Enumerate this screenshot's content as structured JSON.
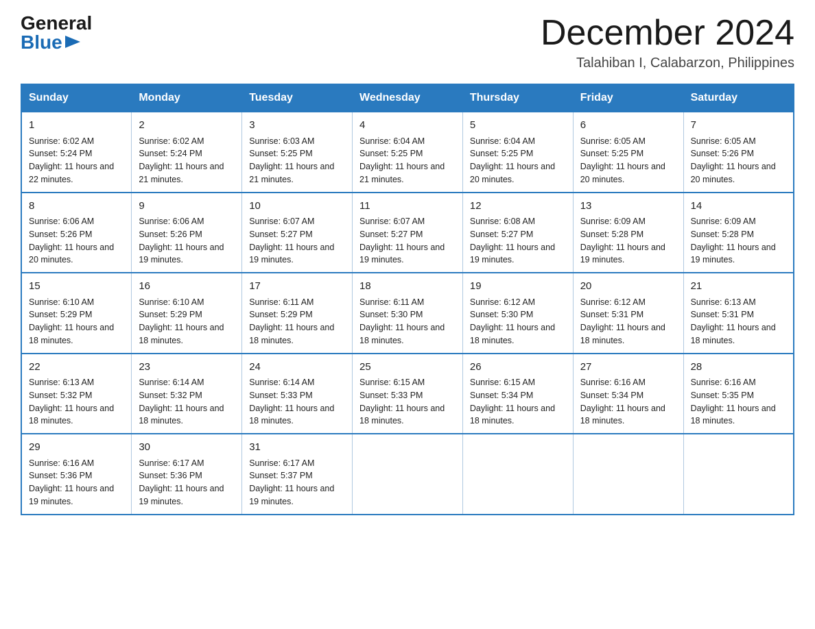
{
  "header": {
    "logo_general": "General",
    "logo_blue": "Blue",
    "month_year": "December 2024",
    "location": "Talahiban I, Calabarzon, Philippines"
  },
  "weekdays": [
    "Sunday",
    "Monday",
    "Tuesday",
    "Wednesday",
    "Thursday",
    "Friday",
    "Saturday"
  ],
  "weeks": [
    [
      {
        "day": "1",
        "sunrise": "6:02 AM",
        "sunset": "5:24 PM",
        "daylight": "11 hours and 22 minutes."
      },
      {
        "day": "2",
        "sunrise": "6:02 AM",
        "sunset": "5:24 PM",
        "daylight": "11 hours and 21 minutes."
      },
      {
        "day": "3",
        "sunrise": "6:03 AM",
        "sunset": "5:25 PM",
        "daylight": "11 hours and 21 minutes."
      },
      {
        "day": "4",
        "sunrise": "6:04 AM",
        "sunset": "5:25 PM",
        "daylight": "11 hours and 21 minutes."
      },
      {
        "day": "5",
        "sunrise": "6:04 AM",
        "sunset": "5:25 PM",
        "daylight": "11 hours and 20 minutes."
      },
      {
        "day": "6",
        "sunrise": "6:05 AM",
        "sunset": "5:25 PM",
        "daylight": "11 hours and 20 minutes."
      },
      {
        "day": "7",
        "sunrise": "6:05 AM",
        "sunset": "5:26 PM",
        "daylight": "11 hours and 20 minutes."
      }
    ],
    [
      {
        "day": "8",
        "sunrise": "6:06 AM",
        "sunset": "5:26 PM",
        "daylight": "11 hours and 20 minutes."
      },
      {
        "day": "9",
        "sunrise": "6:06 AM",
        "sunset": "5:26 PM",
        "daylight": "11 hours and 19 minutes."
      },
      {
        "day": "10",
        "sunrise": "6:07 AM",
        "sunset": "5:27 PM",
        "daylight": "11 hours and 19 minutes."
      },
      {
        "day": "11",
        "sunrise": "6:07 AM",
        "sunset": "5:27 PM",
        "daylight": "11 hours and 19 minutes."
      },
      {
        "day": "12",
        "sunrise": "6:08 AM",
        "sunset": "5:27 PM",
        "daylight": "11 hours and 19 minutes."
      },
      {
        "day": "13",
        "sunrise": "6:09 AM",
        "sunset": "5:28 PM",
        "daylight": "11 hours and 19 minutes."
      },
      {
        "day": "14",
        "sunrise": "6:09 AM",
        "sunset": "5:28 PM",
        "daylight": "11 hours and 19 minutes."
      }
    ],
    [
      {
        "day": "15",
        "sunrise": "6:10 AM",
        "sunset": "5:29 PM",
        "daylight": "11 hours and 18 minutes."
      },
      {
        "day": "16",
        "sunrise": "6:10 AM",
        "sunset": "5:29 PM",
        "daylight": "11 hours and 18 minutes."
      },
      {
        "day": "17",
        "sunrise": "6:11 AM",
        "sunset": "5:29 PM",
        "daylight": "11 hours and 18 minutes."
      },
      {
        "day": "18",
        "sunrise": "6:11 AM",
        "sunset": "5:30 PM",
        "daylight": "11 hours and 18 minutes."
      },
      {
        "day": "19",
        "sunrise": "6:12 AM",
        "sunset": "5:30 PM",
        "daylight": "11 hours and 18 minutes."
      },
      {
        "day": "20",
        "sunrise": "6:12 AM",
        "sunset": "5:31 PM",
        "daylight": "11 hours and 18 minutes."
      },
      {
        "day": "21",
        "sunrise": "6:13 AM",
        "sunset": "5:31 PM",
        "daylight": "11 hours and 18 minutes."
      }
    ],
    [
      {
        "day": "22",
        "sunrise": "6:13 AM",
        "sunset": "5:32 PM",
        "daylight": "11 hours and 18 minutes."
      },
      {
        "day": "23",
        "sunrise": "6:14 AM",
        "sunset": "5:32 PM",
        "daylight": "11 hours and 18 minutes."
      },
      {
        "day": "24",
        "sunrise": "6:14 AM",
        "sunset": "5:33 PM",
        "daylight": "11 hours and 18 minutes."
      },
      {
        "day": "25",
        "sunrise": "6:15 AM",
        "sunset": "5:33 PM",
        "daylight": "11 hours and 18 minutes."
      },
      {
        "day": "26",
        "sunrise": "6:15 AM",
        "sunset": "5:34 PM",
        "daylight": "11 hours and 18 minutes."
      },
      {
        "day": "27",
        "sunrise": "6:16 AM",
        "sunset": "5:34 PM",
        "daylight": "11 hours and 18 minutes."
      },
      {
        "day": "28",
        "sunrise": "6:16 AM",
        "sunset": "5:35 PM",
        "daylight": "11 hours and 18 minutes."
      }
    ],
    [
      {
        "day": "29",
        "sunrise": "6:16 AM",
        "sunset": "5:36 PM",
        "daylight": "11 hours and 19 minutes."
      },
      {
        "day": "30",
        "sunrise": "6:17 AM",
        "sunset": "5:36 PM",
        "daylight": "11 hours and 19 minutes."
      },
      {
        "day": "31",
        "sunrise": "6:17 AM",
        "sunset": "5:37 PM",
        "daylight": "11 hours and 19 minutes."
      },
      null,
      null,
      null,
      null
    ]
  ]
}
